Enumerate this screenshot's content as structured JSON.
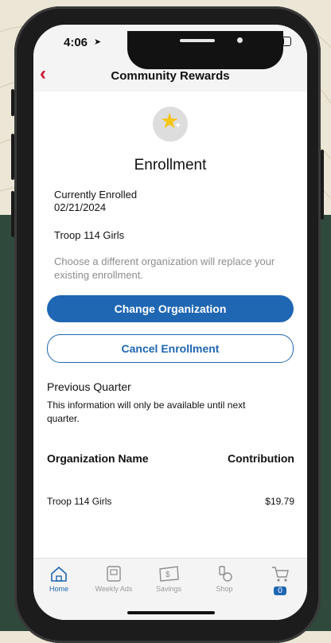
{
  "status_bar": {
    "time": "4:06",
    "location_glyph": "➤"
  },
  "nav": {
    "back_glyph": "‹",
    "title": "Community Rewards"
  },
  "enrollment": {
    "heading": "Enrollment",
    "status_label": "Currently Enrolled",
    "date": "02/21/2024",
    "organization": "Troop 114 Girls",
    "note": "Choose a different organization will replace your existing enrollment."
  },
  "buttons": {
    "change_org": "Change Organization",
    "cancel_enrollment": "Cancel Enrollment"
  },
  "previous_quarter": {
    "heading": "Previous Quarter",
    "info": "This information will only be available until next quarter.",
    "col_org": "Organization Name",
    "col_contrib": "Contribution",
    "rows": [
      {
        "org": "Troop 114 Girls",
        "amount": "$19.79"
      }
    ]
  },
  "tabbar": {
    "items": [
      {
        "label": "Home",
        "icon": "home-icon",
        "active": true
      },
      {
        "label": "Weekly Ads",
        "icon": "weekly-ads-icon"
      },
      {
        "label": "Savings",
        "icon": "savings-icon"
      },
      {
        "label": "Shop",
        "icon": "shop-icon"
      },
      {
        "label": "",
        "icon": "cart-icon"
      }
    ],
    "cart_count": "0"
  },
  "colors": {
    "accent": "#1f66b3",
    "back_arrow": "#c8102e",
    "background_top": "#ece6d6",
    "background_bottom": "#2f4a3d"
  }
}
